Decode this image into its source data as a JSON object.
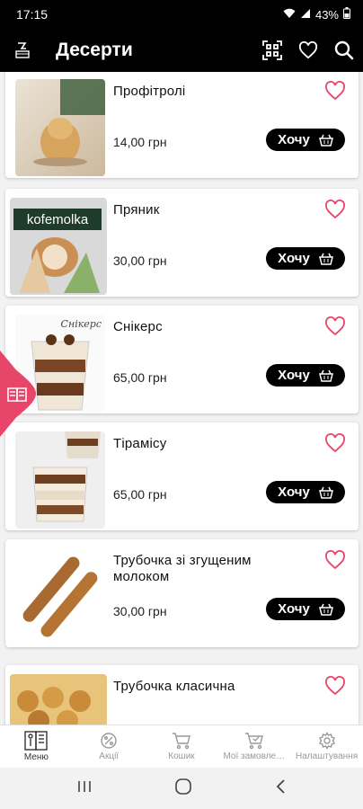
{
  "status": {
    "time": "17:15",
    "battery": "43%"
  },
  "header": {
    "title": "Десерти"
  },
  "products": [
    {
      "name": "Профітролі",
      "price": "14,00 грн",
      "button": "Хочу"
    },
    {
      "name": "Пряник",
      "price": "30,00 грн",
      "button": "Хочу",
      "thumb_text": "kofemolka"
    },
    {
      "name": "Снікерс",
      "price": "65,00 грн",
      "button": "Хочу",
      "thumb_text": "Снікерс"
    },
    {
      "name": "Тірамісу",
      "price": "65,00 грн",
      "button": "Хочу"
    },
    {
      "name": "Трубочка зі згущеним молоком",
      "price": "30,00 грн",
      "button": "Хочу"
    },
    {
      "name": "Трубочка класична",
      "price": "",
      "button": ""
    }
  ],
  "nav": [
    {
      "label": "Меню",
      "icon": "menu-book-icon",
      "active": true
    },
    {
      "label": "Акції",
      "icon": "percent-icon",
      "active": false
    },
    {
      "label": "Кошик",
      "icon": "cart-icon",
      "active": false
    },
    {
      "label": "Мої замовле…",
      "icon": "orders-icon",
      "active": false
    },
    {
      "label": "Налаштування",
      "icon": "gear-icon",
      "active": false
    }
  ],
  "colors": {
    "accent": "#e8456a",
    "bar": "#000000"
  }
}
